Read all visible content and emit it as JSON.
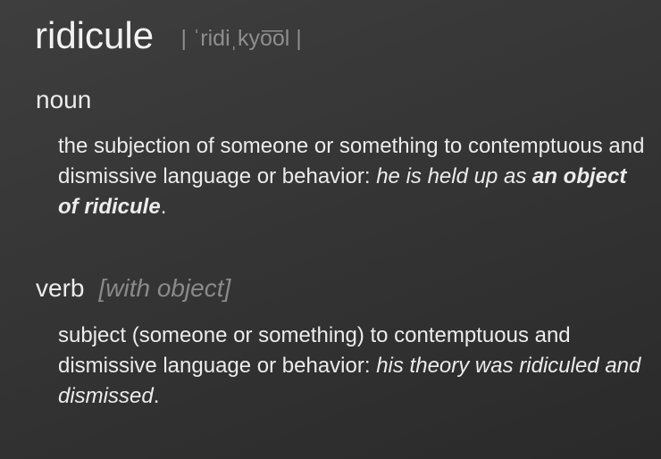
{
  "entry": {
    "headword": "ridicule",
    "pronunciation": "| ˈridiˌkyo͞ol |"
  },
  "senses": [
    {
      "pos": "noun",
      "qualifier": "",
      "definition": "the subjection of someone or something to contemptuous and dismissive language or behavior:",
      "example_before": "he is held up as ",
      "example_bold": "an object of ridicule",
      "example_after": "."
    },
    {
      "pos": "verb",
      "qualifier": "[with object]",
      "definition": "subject (someone or something) to contemptuous and dismissive language or behavior:",
      "example": "his theory was ridiculed and dismissed",
      "example_after": "."
    }
  ]
}
